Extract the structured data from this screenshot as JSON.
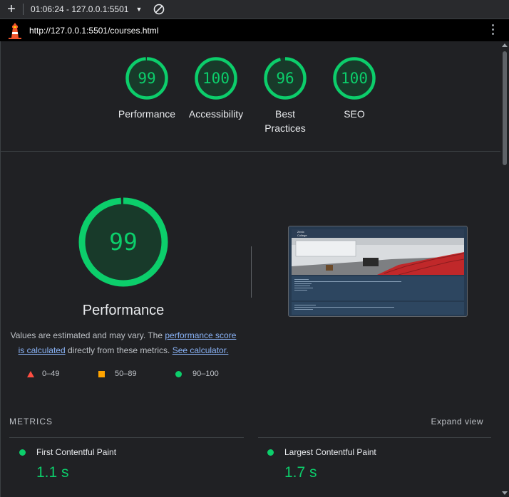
{
  "toolbar": {
    "new_label": "+",
    "report_label": "01:06:24 - 127.0.0.1:5501",
    "caret": "▼",
    "clear_icon": "block-icon"
  },
  "urlbar": {
    "url": "http://127.0.0.1:5501/courses.html",
    "logo_icon": "lighthouse-icon",
    "menu_icon": "kebab-menu-icon"
  },
  "gauges": [
    {
      "label": "Performance",
      "score": "99",
      "fraction": 0.99
    },
    {
      "label": "Accessibility",
      "score": "100",
      "fraction": 1.0
    },
    {
      "label": "Best Practices",
      "score": "96",
      "fraction": 0.96
    },
    {
      "label": "SEO",
      "score": "100",
      "fraction": 1.0
    }
  ],
  "performance": {
    "score": "99",
    "fraction": 0.99,
    "title": "Performance",
    "note_prefix": "Values are estimated and may vary. The ",
    "note_link1": "performance score is calculated",
    "note_middle": " directly from these metrics. ",
    "note_link2": "See calculator."
  },
  "legend": {
    "fail": "0–49",
    "average": "50–89",
    "pass": "90–100"
  },
  "thumbnail": {
    "logo_line1": "Zenix",
    "logo_line2": "College"
  },
  "metrics": {
    "heading": "METRICS",
    "expand_label": "Expand view",
    "items": [
      {
        "name": "First Contentful Paint",
        "value": "1.1 s"
      },
      {
        "name": "Largest Contentful Paint",
        "value": "1.7 s"
      }
    ]
  },
  "colors": {
    "pass": "#0cce6b",
    "average": "#ffa400",
    "fail": "#ff4e42",
    "link": "#8ab4f8",
    "background": "#202124"
  }
}
